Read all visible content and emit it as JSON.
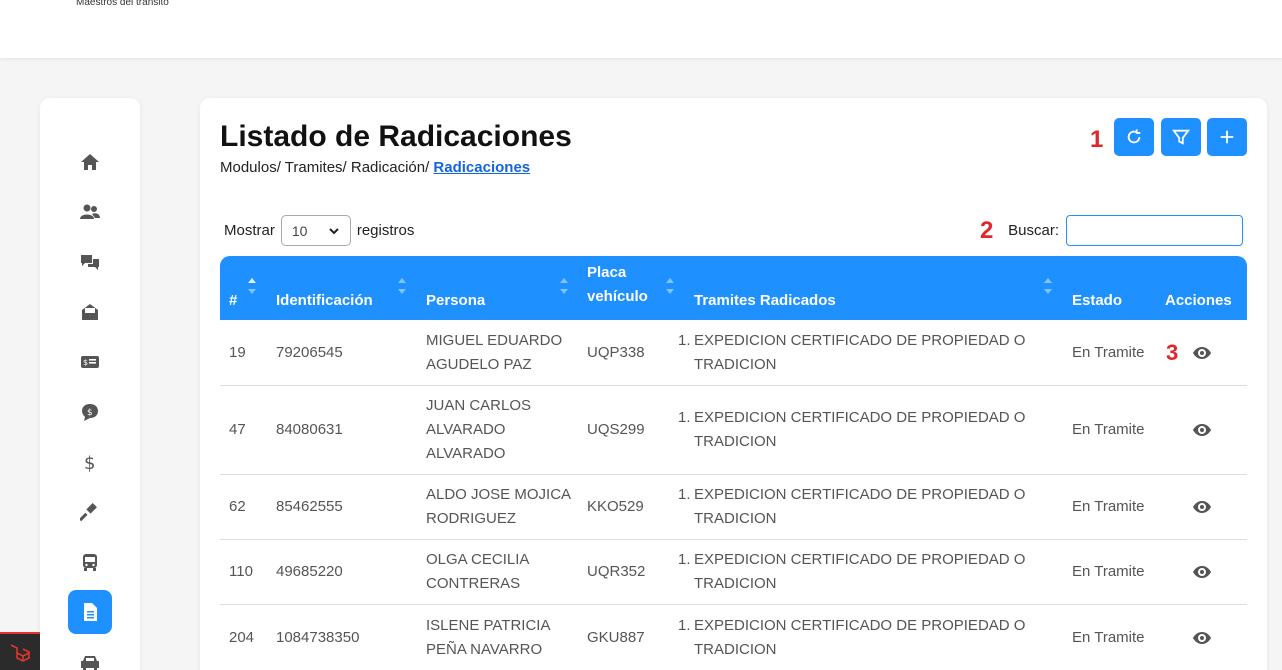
{
  "header": {
    "subtitle": "Maestros del tránsito"
  },
  "sidebar": {
    "items": [
      {
        "icon": "home-icon"
      },
      {
        "icon": "users-icon"
      },
      {
        "icon": "question-chat-icon"
      },
      {
        "icon": "inbox-icon"
      },
      {
        "icon": "id-card-icon"
      },
      {
        "icon": "dollar-chat-icon"
      },
      {
        "icon": "dollar-icon"
      },
      {
        "icon": "gavel-icon"
      },
      {
        "icon": "bus-icon"
      },
      {
        "icon": "document-icon",
        "active": true
      },
      {
        "icon": "car-icon"
      }
    ]
  },
  "page": {
    "title": "Listado de Radicaciones",
    "breadcrumb_prefix": "Modulos/ Tramites/ Radicación/ ",
    "breadcrumb_current": "Radicaciones"
  },
  "annotations": {
    "one": "1",
    "two": "2",
    "three": "3"
  },
  "toolbar": {
    "buttons": [
      "refresh-icon",
      "filter-icon",
      "plus-icon"
    ]
  },
  "controls": {
    "show_label": "Mostrar",
    "page_size": "10",
    "records_label": "registros",
    "search_label": "Buscar:",
    "search_value": ""
  },
  "table": {
    "headers": [
      "#",
      "Identificación",
      "Persona",
      "Placa vehículo",
      "Tramites Radicados",
      "Estado",
      "Acciones"
    ],
    "header_placa_line1": "Placa",
    "header_placa_line2": "vehículo",
    "rows": [
      {
        "id": "19",
        "identificacion": "79206545",
        "persona_l1": "MIGUEL EDUARDO",
        "persona_l2": "AGUDELO PAZ",
        "persona_l3": "",
        "placa": "UQP338",
        "tramite_num": "1.",
        "tramite_l1": "EXPEDICION CERTIFICADO DE PROPIEDAD O",
        "tramite_l2": "TRADICION",
        "estado": "En Tramite"
      },
      {
        "id": "47",
        "identificacion": "84080631",
        "persona_l1": "JUAN CARLOS",
        "persona_l2": "ALVARADO",
        "persona_l3": "ALVARADO",
        "placa": "UQS299",
        "tramite_num": "1.",
        "tramite_l1": "EXPEDICION CERTIFICADO DE PROPIEDAD O",
        "tramite_l2": "TRADICION",
        "estado": "En Tramite"
      },
      {
        "id": "62",
        "identificacion": "85462555",
        "persona_l1": "ALDO JOSE MOJICA",
        "persona_l2": "RODRIGUEZ",
        "persona_l3": "",
        "placa": "KKO529",
        "tramite_num": "1.",
        "tramite_l1": "EXPEDICION CERTIFICADO DE PROPIEDAD O",
        "tramite_l2": "TRADICION",
        "estado": "En Tramite"
      },
      {
        "id": "110",
        "identificacion": "49685220",
        "persona_l1": "OLGA CECILIA",
        "persona_l2": "CONTRERAS",
        "persona_l3": "",
        "placa": "UQR352",
        "tramite_num": "1.",
        "tramite_l1": "EXPEDICION CERTIFICADO DE PROPIEDAD O",
        "tramite_l2": "TRADICION",
        "estado": "En Tramite"
      },
      {
        "id": "204",
        "identificacion": "1084738350",
        "persona_l1": "ISLENE PATRICIA",
        "persona_l2": "PEÑA NAVARRO",
        "persona_l3": "",
        "placa": "GKU887",
        "tramite_num": "1.",
        "tramite_l1": "EXPEDICION CERTIFICADO DE PROPIEDAD O",
        "tramite_l2": "TRADICION",
        "estado": "En Tramite"
      }
    ]
  },
  "colors": {
    "accent": "#1e90ff",
    "annotation": "#e3262b",
    "link": "#1565e0"
  }
}
